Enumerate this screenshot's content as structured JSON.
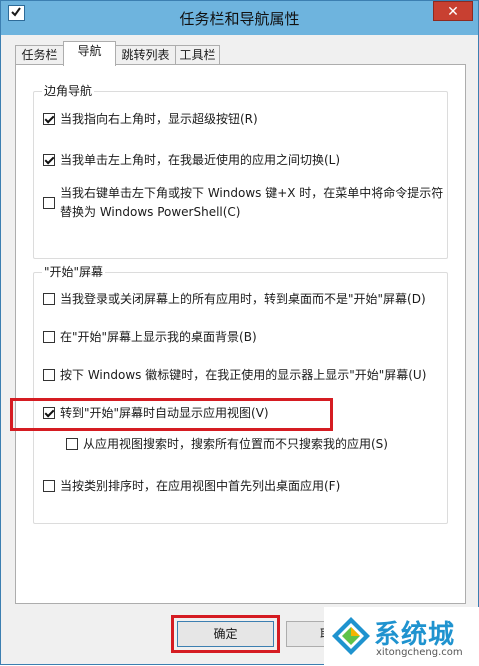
{
  "window": {
    "title": "任务栏和导航属性",
    "close_glyph": "✕"
  },
  "tabs": [
    {
      "label": "任务栏"
    },
    {
      "label": "导航"
    },
    {
      "label": "跳转列表"
    },
    {
      "label": "工具栏"
    }
  ],
  "active_tab": "导航",
  "corner_nav": {
    "label": "边角导航",
    "options": [
      {
        "line1": "当我指向右上角时，显示超级按钮(R)",
        "checked": true
      },
      {
        "line1": "当我单击左上角时，在我最近使用的应用之间切换(L)",
        "checked": true
      },
      {
        "line1": "当我右键单击左下角或按下 Windows 键+X 时，在菜单中将命令提示符",
        "line2": "替换为 Windows PowerShell(C)",
        "checked": false
      }
    ]
  },
  "start_screen": {
    "label": "\"开始\"屏幕",
    "options": [
      {
        "line1": "当我登录或关闭屏幕上的所有应用时，转到桌面而不是\"开始\"屏幕(D)",
        "checked": false
      },
      {
        "line1": "在\"开始\"屏幕上显示我的桌面背景(B)",
        "checked": false
      },
      {
        "line1": "按下 Windows 徽标键时，在我正使用的显示器上显示\"开始\"屏幕(U)",
        "checked": false
      },
      {
        "line1": "转到\"开始\"屏幕时自动显示应用视图(V)",
        "checked": true
      },
      {
        "line1": "从应用视图搜索时，搜索所有位置而不只搜索我的应用(S)",
        "checked": false
      },
      {
        "line1": "当按类别排序时，在应用视图中首先列出桌面应用(F)",
        "checked": false
      }
    ]
  },
  "buttons": {
    "ok": "确定",
    "cancel": "取"
  },
  "watermark": {
    "text": "系统城",
    "url": "xitongcheng.com"
  },
  "colors": {
    "titlebar": "#6eb4de",
    "close": "#c84031",
    "highlight": "#d51c22",
    "watermark": "#1f93cf"
  }
}
